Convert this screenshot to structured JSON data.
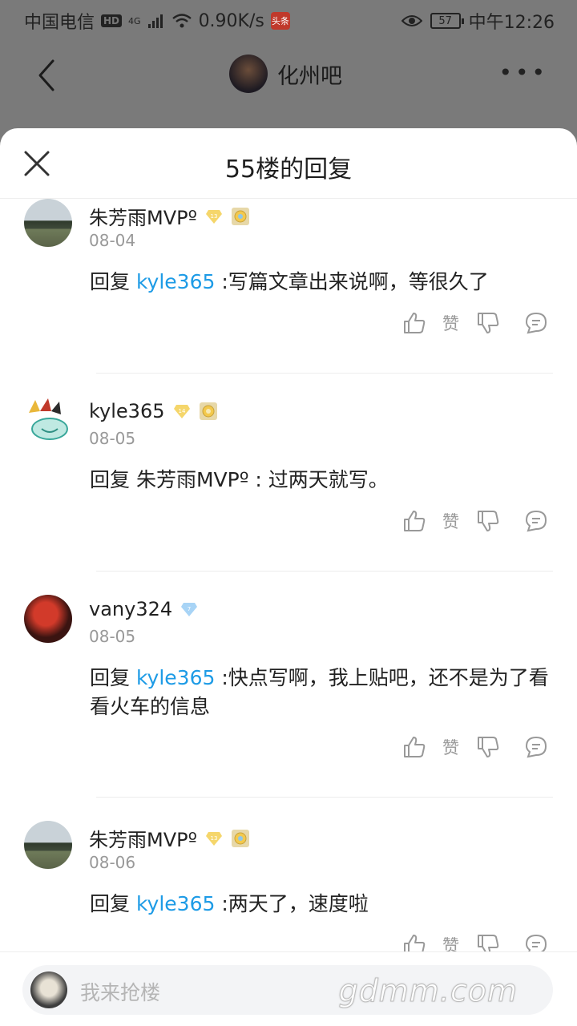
{
  "status_bar": {
    "carrier": "中国电信",
    "hd": "HD",
    "network": "4G",
    "speed": "0.90K/s",
    "app_badge": "头条",
    "battery": "57",
    "time": "中午12:26"
  },
  "header": {
    "forum_name": "化州吧"
  },
  "sheet": {
    "title": "55楼的回复"
  },
  "replies": [
    {
      "username": "朱芳雨MVPº",
      "level": "13",
      "level_color": "#f1c74a",
      "has_medal": true,
      "date": "08-04",
      "prefix": "回复 ",
      "mention": "kyle365",
      "text": " :写篇文章出来说啊，等很久了",
      "like_label": "赞"
    },
    {
      "username": "kyle365",
      "level": "14",
      "level_color": "#f1c74a",
      "has_medal": true,
      "date": "08-05",
      "prefix": "回复 朱芳雨MVPº : 过两天就写。",
      "mention": "",
      "text": "",
      "like_label": "赞"
    },
    {
      "username": "vany324",
      "level": "7",
      "level_color": "#8ec8f4",
      "has_medal": false,
      "date": "08-05",
      "prefix": "回复 ",
      "mention": "kyle365",
      "text": " :快点写啊，我上贴吧，还不是为了看看火车的信息",
      "like_label": "赞"
    },
    {
      "username": "朱芳雨MVPº",
      "level": "13",
      "level_color": "#f1c74a",
      "has_medal": true,
      "date": "08-06",
      "prefix": "回复 ",
      "mention": "kyle365",
      "text": " :两天了，速度啦",
      "like_label": "赞"
    }
  ],
  "bottom": {
    "placeholder": "我来抢楼",
    "watermark": "gdmm.com"
  },
  "colors": {
    "mention": "#1d9be6",
    "icon_gray": "#9a9a9a"
  }
}
